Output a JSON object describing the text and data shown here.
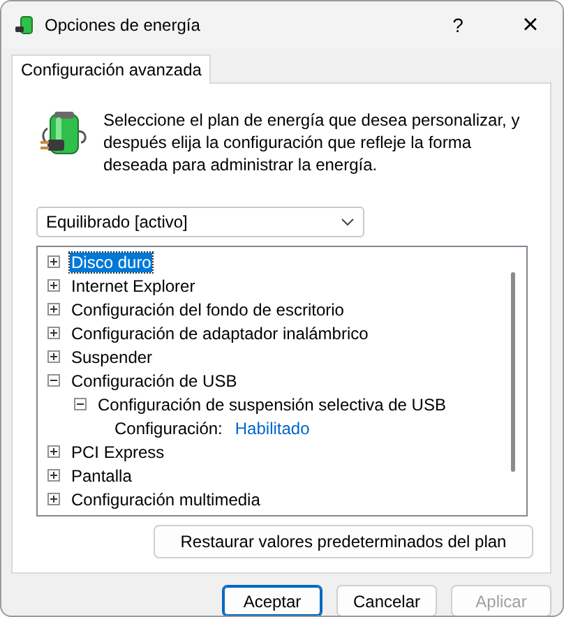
{
  "window": {
    "title": "Opciones de energía",
    "help": "?",
    "close": "×"
  },
  "tabs": [
    {
      "label": "Configuración avanzada",
      "selected": true
    }
  ],
  "description": "Seleccione el plan de energía que desea personalizar, y después elija la configuración que refleje la forma deseada para administrar la energía.",
  "plan_select": {
    "value": "Equilibrado [activo]"
  },
  "tree": [
    {
      "kind": "group",
      "label": "Disco duro",
      "expanded": false,
      "selected": true
    },
    {
      "kind": "group",
      "label": "Internet Explorer",
      "expanded": false,
      "selected": false
    },
    {
      "kind": "group",
      "label": "Configuración del fondo de escritorio",
      "expanded": false,
      "selected": false
    },
    {
      "kind": "group",
      "label": "Configuración de adaptador inalámbrico",
      "expanded": false,
      "selected": false
    },
    {
      "kind": "group",
      "label": "Suspender",
      "expanded": false,
      "selected": false
    },
    {
      "kind": "group",
      "label": "Configuración de USB",
      "expanded": true,
      "selected": false,
      "children": [
        {
          "kind": "group",
          "label": "Configuración de suspensión selectiva de USB",
          "expanded": true,
          "selected": false,
          "children": [
            {
              "kind": "setting",
              "label": "Configuración:",
              "value": "Habilitado",
              "selected": false
            }
          ]
        }
      ]
    },
    {
      "kind": "group",
      "label": "PCI Express",
      "expanded": false,
      "selected": false
    },
    {
      "kind": "group",
      "label": "Pantalla",
      "expanded": false,
      "selected": false
    },
    {
      "kind": "group",
      "label": "Configuración multimedia",
      "expanded": false,
      "selected": false
    }
  ],
  "restore_button": "Restaurar valores predeterminados del plan",
  "buttons": [
    {
      "label": "Aceptar",
      "kind": "default",
      "disabled": false
    },
    {
      "label": "Cancelar",
      "kind": "normal",
      "disabled": false
    },
    {
      "label": "Aplicar",
      "kind": "normal",
      "disabled": true
    }
  ]
}
